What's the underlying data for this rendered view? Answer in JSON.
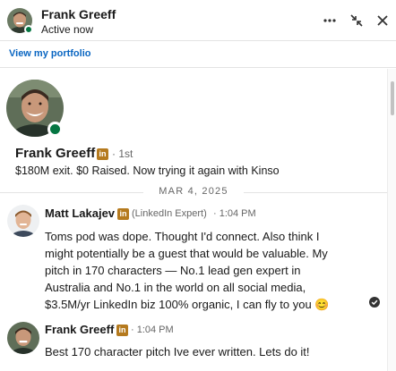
{
  "header": {
    "name": "Frank Greeff",
    "status": "Active now",
    "more_icon": "ellipsis-icon",
    "minimize_icon": "collapse-arrows-icon",
    "close_icon": "close-icon"
  },
  "portfolio": {
    "label": "View my portfolio"
  },
  "profile": {
    "name": "Frank Greeff",
    "degree": "· 1st",
    "headline": "$180M exit. $0 Raised. Now trying it again with Kinso"
  },
  "divider": {
    "date": "MAR 4, 2025"
  },
  "messages": [
    {
      "sender": "Matt Lakajev",
      "badge": "(LinkedIn Expert)",
      "time": "· 1:04 PM",
      "lines": [
        "Toms pod was dope. Thought I'd connect. Also think I",
        "might potentially be a guest that would be valuable. My",
        "pitch in 170 characters — No.1 lead gen expert in",
        "Australia and No.1 in the world on all social media,",
        "$3.5M/yr LinkedIn biz 100% organic, I can fly to you 😊"
      ]
    },
    {
      "sender": "Frank Greeff",
      "time": "· 1:04 PM",
      "lines": [
        "Best 170 character pitch Ive ever written. Lets do it!"
      ]
    }
  ],
  "colors": {
    "accent": "#0a66c2",
    "online": "#057642",
    "linkedin_badge": "#b57a1e"
  }
}
